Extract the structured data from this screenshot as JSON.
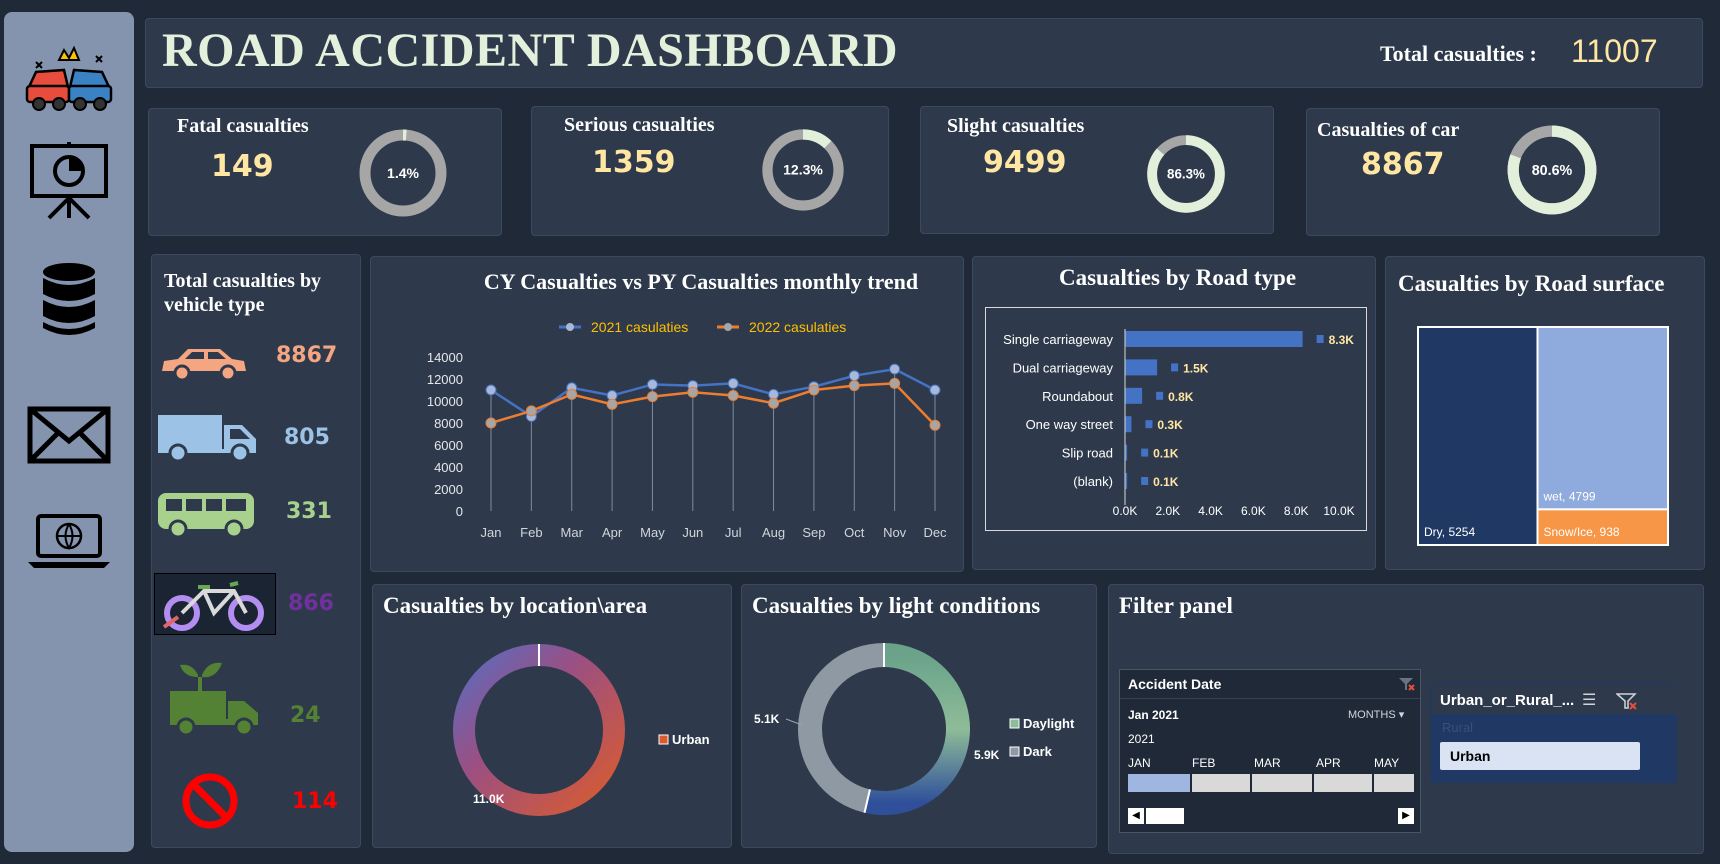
{
  "header": {
    "title": "ROAD ACCIDENT DASHBOARD",
    "total_label": "Total casualties :",
    "total_value": "11007"
  },
  "sidebar": {
    "icons": [
      "car-crash-icon",
      "presentation-chart-icon",
      "database-icon",
      "mail-icon",
      "laptop-globe-icon"
    ]
  },
  "kpis": [
    {
      "label": "Fatal casualties",
      "value": "149",
      "pct": 1.4,
      "pct_label": "1.4%"
    },
    {
      "label": "Serious casualties",
      "value": "1359",
      "pct": 12.3,
      "pct_label": "12.3%"
    },
    {
      "label": "Slight casualties",
      "value": "9499",
      "pct": 86.3,
      "pct_label": "86.3%"
    },
    {
      "label": "Casualties of car",
      "value": "8867",
      "pct": 80.6,
      "pct_label": "80.6%"
    }
  ],
  "vehicle": {
    "title": "Total casualties by vehicle type",
    "items": [
      {
        "icon": "car-icon",
        "value": "8867",
        "color": "#f4a582"
      },
      {
        "icon": "truck-icon",
        "value": "805",
        "color": "#9cc3e6"
      },
      {
        "icon": "bus-icon",
        "value": "331",
        "color": "#a9d18e"
      },
      {
        "icon": "bike-icon",
        "value": "866",
        "color": "#7030a0"
      },
      {
        "icon": "agri-vehicle-icon",
        "value": "24",
        "color": "#548235"
      },
      {
        "icon": "no-entry-icon",
        "value": "114",
        "color": "#ff0000"
      }
    ]
  },
  "colors": {
    "accent_value": "#ffe7a3",
    "series_2021": "#4472c4",
    "series_2022": "#ed7d31",
    "bar": "#4472c4",
    "legend_text": "#ffc000"
  },
  "chart_data": [
    {
      "type": "line",
      "title": "CY Casualties vs PY Casualties monthly trend",
      "categories": [
        "Jan",
        "Feb",
        "Mar",
        "Apr",
        "May",
        "Jun",
        "Jul",
        "Aug",
        "Sep",
        "Oct",
        "Nov",
        "Dec"
      ],
      "series": [
        {
          "name": "2021 casulaties",
          "values": [
            11000,
            8600,
            11200,
            10500,
            11500,
            11400,
            11600,
            10600,
            11300,
            12300,
            12900,
            11000
          ]
        },
        {
          "name": "2022 casulaties",
          "values": [
            8000,
            9100,
            10600,
            9700,
            10400,
            10800,
            10500,
            9800,
            11000,
            11400,
            11600,
            7800
          ]
        }
      ],
      "ylim": [
        0,
        14000
      ],
      "yticks": [
        "0",
        "2000",
        "4000",
        "6000",
        "8000",
        "10000",
        "12000",
        "14000"
      ],
      "grid": false,
      "legend": "top"
    },
    {
      "type": "bar",
      "orientation": "horizontal",
      "title": "Casualties by Road type",
      "categories": [
        "Single carriageway",
        "Dual carriageway",
        "Roundabout",
        "One way street",
        "Slip road",
        "(blank)"
      ],
      "values": [
        8300,
        1500,
        800,
        300,
        100,
        100
      ],
      "labels": [
        "8.3K",
        "1.5K",
        "0.8K",
        "0.3K",
        "0.1K",
        "0.1K"
      ],
      "xlim": [
        0,
        10000
      ],
      "xticks": [
        "0.0K",
        "2.0K",
        "4.0K",
        "6.0K",
        "8.0K",
        "10.0K"
      ]
    },
    {
      "type": "treemap",
      "title": "Casualties by Road surface",
      "items": [
        {
          "label": "Dry, 5254",
          "value": 5254,
          "color": "#1f3864"
        },
        {
          "label": "wet, 4799",
          "value": 4799,
          "color": "#8faadc"
        },
        {
          "label": "Snow/Ice, 938",
          "value": 938,
          "color": "#f79646"
        }
      ]
    },
    {
      "type": "pie",
      "donut": true,
      "title": "Casualties by location\\area",
      "slices": [
        {
          "name": "Urban",
          "value": 11000,
          "label": "11.0K"
        }
      ],
      "legend": "right"
    },
    {
      "type": "pie",
      "donut": true,
      "title": "Casualties by light conditions",
      "slices": [
        {
          "name": "Daylight",
          "value": 5900,
          "label": "5.9K"
        },
        {
          "name": "Dark",
          "value": 5100,
          "label": "5.1K"
        }
      ],
      "legend": "right"
    }
  ],
  "filter": {
    "title": "Filter panel",
    "timeline": {
      "title": "Accident Date",
      "selected": "Jan 2021",
      "unit": "MONTHS",
      "year": "2021",
      "months": [
        "JAN",
        "FEB",
        "MAR",
        "APR",
        "MAY"
      ]
    },
    "slicer": {
      "title": "Urban_or_Rural_...",
      "items": [
        "Rural",
        "Urban"
      ]
    }
  }
}
